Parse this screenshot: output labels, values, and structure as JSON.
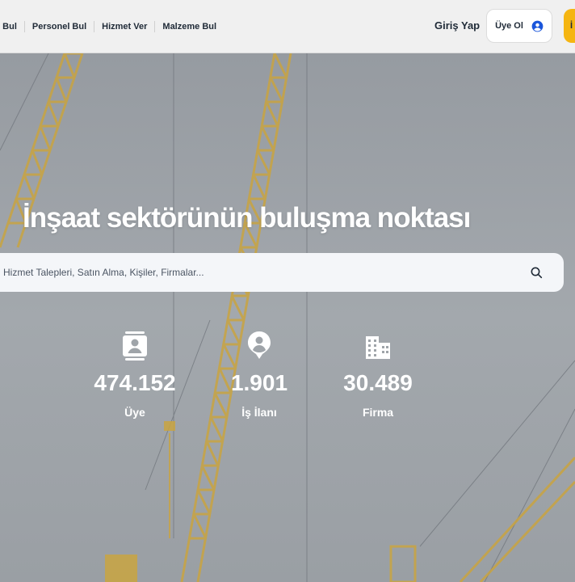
{
  "nav": {
    "items": [
      {
        "label": "ş Bul"
      },
      {
        "label": "Personel Bul"
      },
      {
        "label": "Hizmet Ver"
      },
      {
        "label": "Malzeme Bul"
      }
    ]
  },
  "header": {
    "login_label": "Giriş Yap",
    "signup_label": "Üye Ol",
    "signup_icon": "user-circle-icon",
    "cta_label": "İ"
  },
  "hero": {
    "headline": "İnşaat sektörünün buluşma noktası",
    "search": {
      "placeholder": "Hizmet Talepleri, Satın Alma, Kişiler, Firmalar...",
      "icon": "search-icon"
    },
    "stats": [
      {
        "icon": "member-card-icon",
        "value": "474.152",
        "label": "Üye"
      },
      {
        "icon": "location-person-icon",
        "value": "1.901",
        "label": "İş İlanı"
      },
      {
        "icon": "building-icon",
        "value": "30.489",
        "label": "Firma"
      }
    ]
  },
  "colors": {
    "accent": "#f5b511",
    "header_bg": "#f0f0f0",
    "user_icon": "#1a56db"
  }
}
